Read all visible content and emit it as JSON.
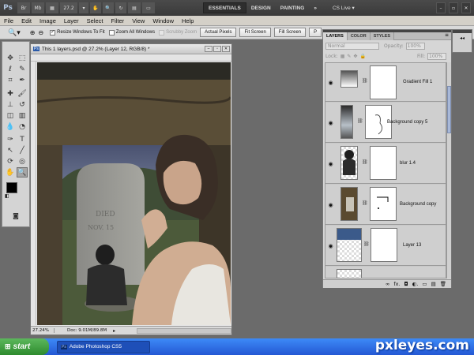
{
  "app": {
    "logo": "Ps",
    "zoom": "27.2",
    "zoom_menu": "▾"
  },
  "workspaces": {
    "essentials": "ESSENTIALS",
    "design": "DESIGN",
    "painting": "PAINTING",
    "more": "»",
    "cs_live": "CS Live ▾"
  },
  "menu": [
    "File",
    "Edit",
    "Image",
    "Layer",
    "Select",
    "Filter",
    "View",
    "Window",
    "Help"
  ],
  "options": {
    "resize": "Resize Windows To Fit",
    "zoom_all": "Zoom All Windows",
    "scrubby": "Scrubby Zoom",
    "actual": "Actual Pixels",
    "fit": "Fit Screen",
    "fill": "Fill Screen",
    "print": "P"
  },
  "document": {
    "title": "This 1 layers.psd @ 27.2% (Layer 12, RGB/8) *",
    "zoom_status": "27.24%",
    "doc_size": "Doc: 9.01M/89.8M"
  },
  "layers_panel": {
    "tabs": [
      "LAYERS",
      "COLOR",
      "STYLES"
    ],
    "blend_mode": "Normal",
    "opacity_label": "Opacity:",
    "opacity": "100%",
    "lock_label": "Lock:",
    "fill_label": "Fill:",
    "fill": "100%",
    "layers": [
      "Gradient Fill 1",
      "Background copy 5",
      "blur 1.4",
      "Background copy",
      "Layer 13",
      ""
    ],
    "footer_icons": [
      "∞",
      "fx.",
      "◘",
      "◐.",
      "▭",
      "▤",
      "🗑"
    ]
  },
  "taskbar": {
    "start": "start",
    "task": "Adobe Photoshop CS5"
  },
  "watermark": "pxleyes.com",
  "tombstone_text": [
    "DIED",
    "NOV. 15"
  ]
}
